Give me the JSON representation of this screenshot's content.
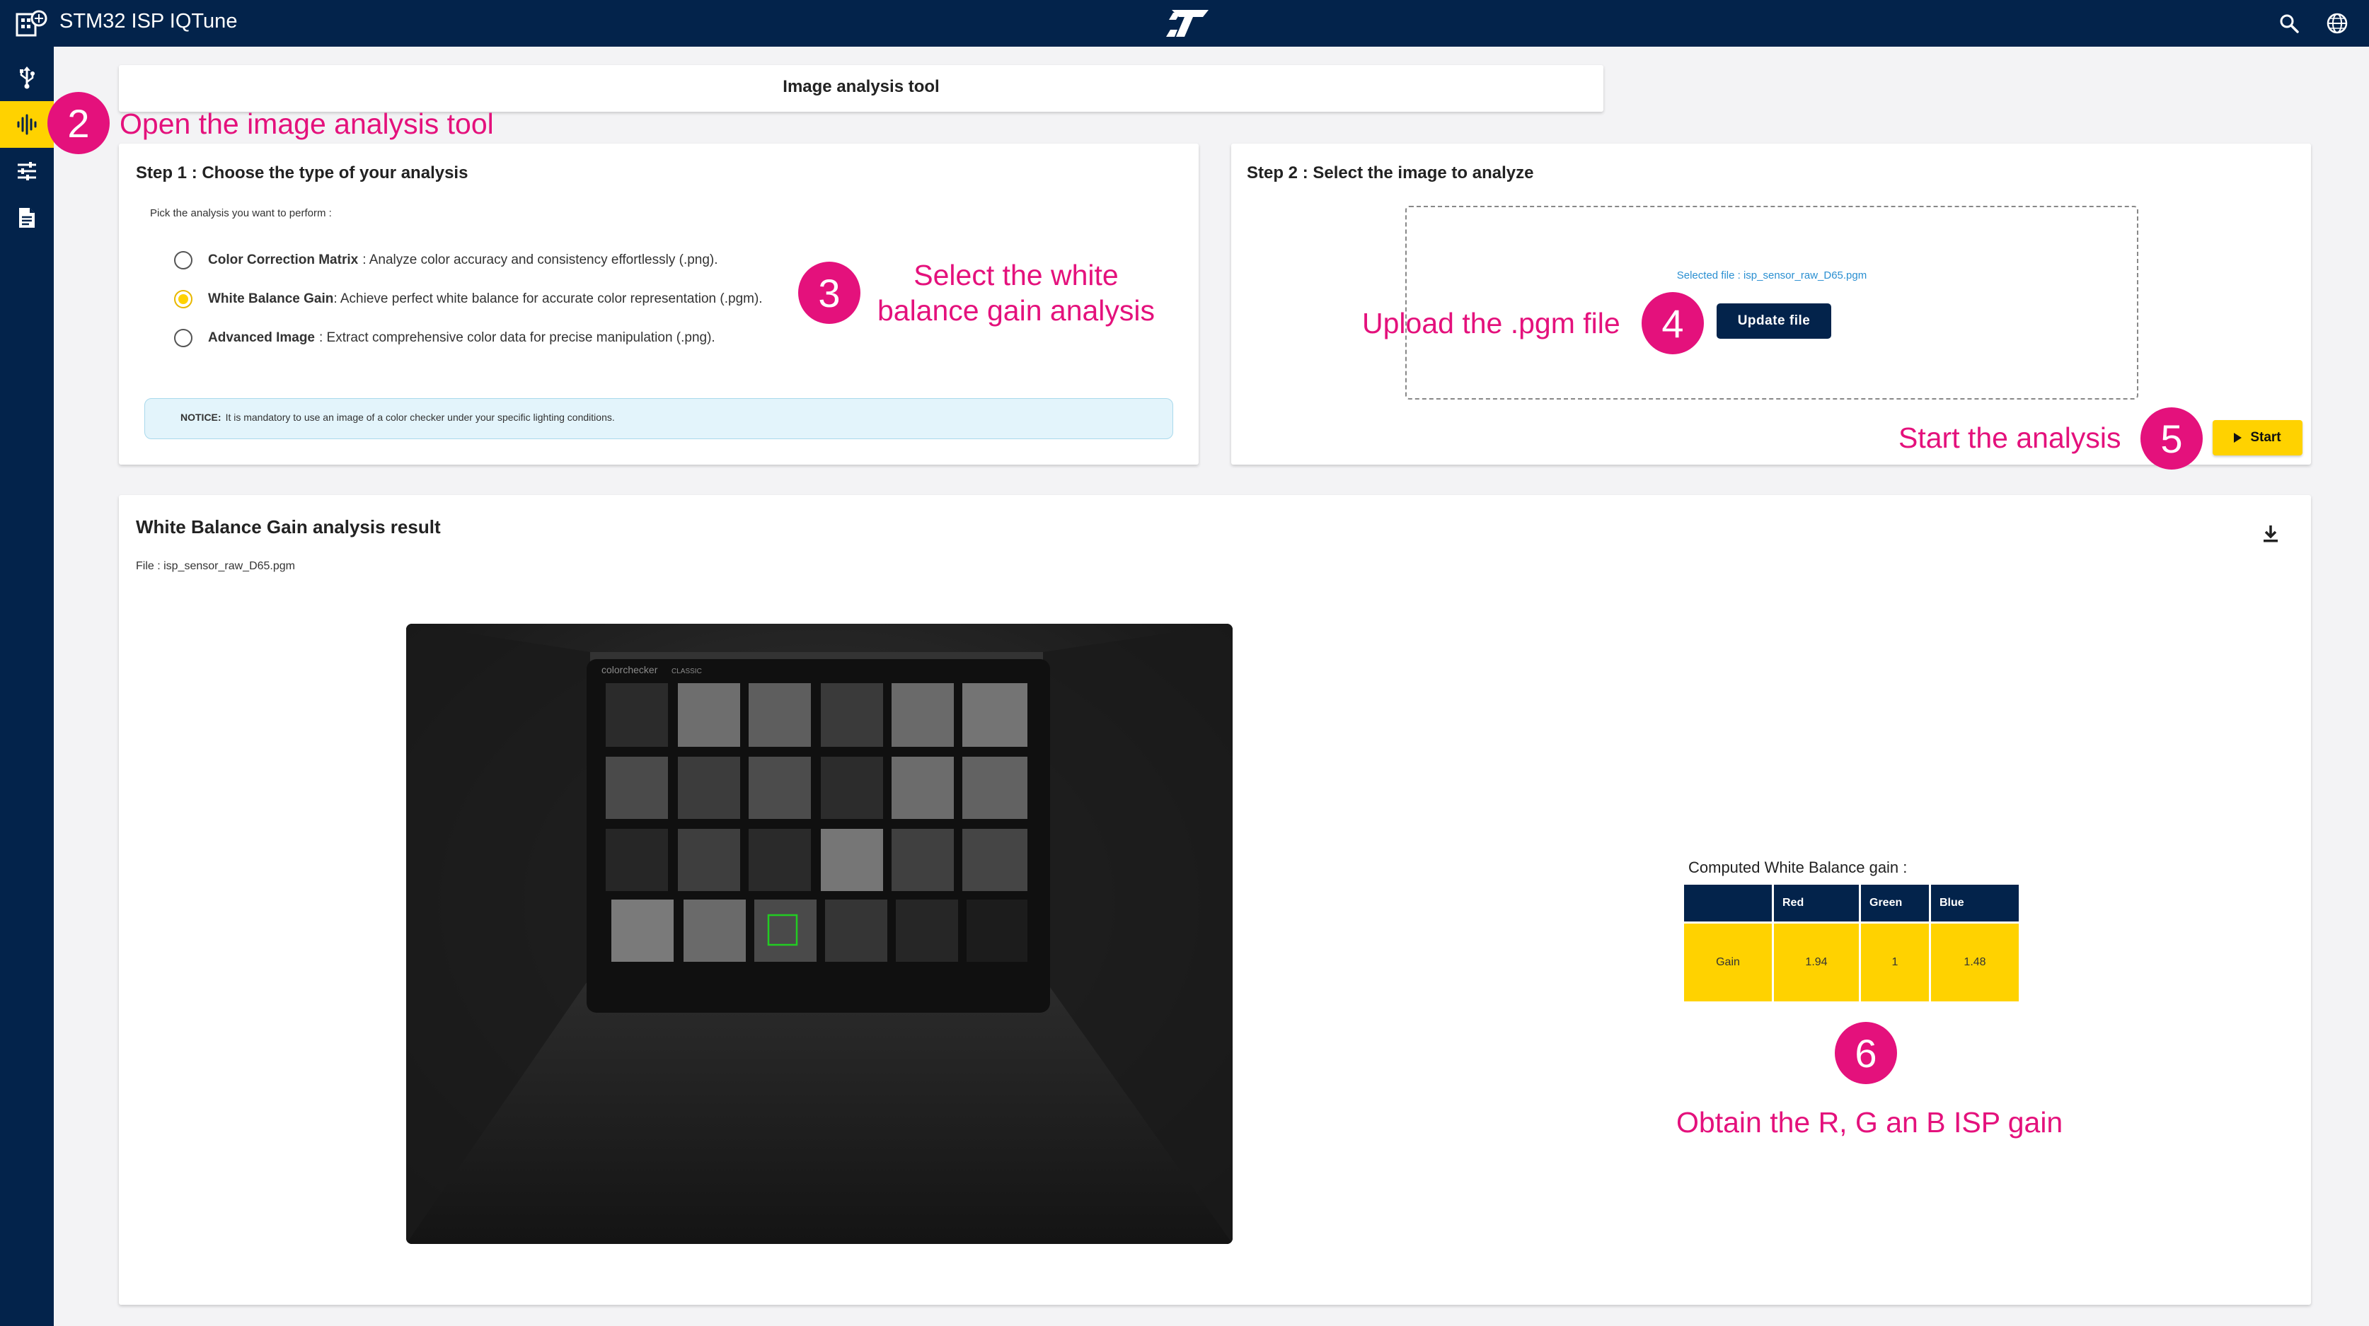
{
  "app": {
    "title": "STM32 ISP IQTune"
  },
  "sidebar": {
    "items": [
      {
        "name": "usb-icon"
      },
      {
        "name": "waveform-icon",
        "active": true
      },
      {
        "name": "sliders-icon"
      },
      {
        "name": "document-icon"
      }
    ]
  },
  "header": {
    "title": "Image analysis tool"
  },
  "step1": {
    "title": "Step 1 : Choose the type of your analysis",
    "prompt": "Pick the analysis you want to perform :",
    "options": [
      {
        "name": "Color Correction Matrix",
        "desc": " : Analyze color accuracy and consistency effortlessly (.png).",
        "checked": false
      },
      {
        "name": "White Balance Gain",
        "desc": ": Achieve perfect white balance for accurate color representation (.pgm).",
        "checked": true
      },
      {
        "name": "Advanced Image",
        "desc": " : Extract comprehensive color data for precise manipulation (.png).",
        "checked": false
      }
    ],
    "notice_label": "NOTICE:",
    "notice_text": "It is mandatory to use an image of a color checker under your specific lighting conditions."
  },
  "step2": {
    "title": "Step 2 : Select the image to analyze",
    "selected_file": "Selected file : isp_sensor_raw_D65.pgm",
    "update_label": "Update file",
    "start_label": "Start"
  },
  "result": {
    "title": "White Balance Gain analysis result",
    "file_line": "File : isp_sensor_raw_D65.pgm",
    "image_brand": "colorchecker",
    "image_subbrand": "CLASSIC",
    "wb_caption": "Computed White Balance gain :",
    "table": {
      "headers": [
        "",
        "Red",
        "Green",
        "Blue"
      ],
      "row": [
        "Gain",
        "1.94",
        "1",
        "1.48"
      ]
    }
  },
  "annotations": {
    "a2": {
      "num": "2",
      "text": "Open the image analysis tool"
    },
    "a3": {
      "num": "3",
      "text_line1": "Select the white",
      "text_line2": "balance gain analysis"
    },
    "a4": {
      "num": "4",
      "text": "Upload the .pgm file"
    },
    "a5": {
      "num": "5",
      "text": "Start the analysis"
    },
    "a6": {
      "num": "6",
      "text": "Obtain the R, G an B ISP gain"
    }
  },
  "colors": {
    "navy": "#03234b",
    "yellow": "#ffd200",
    "accent_pink": "#e4117c",
    "link_blue": "#2a8fd1"
  }
}
